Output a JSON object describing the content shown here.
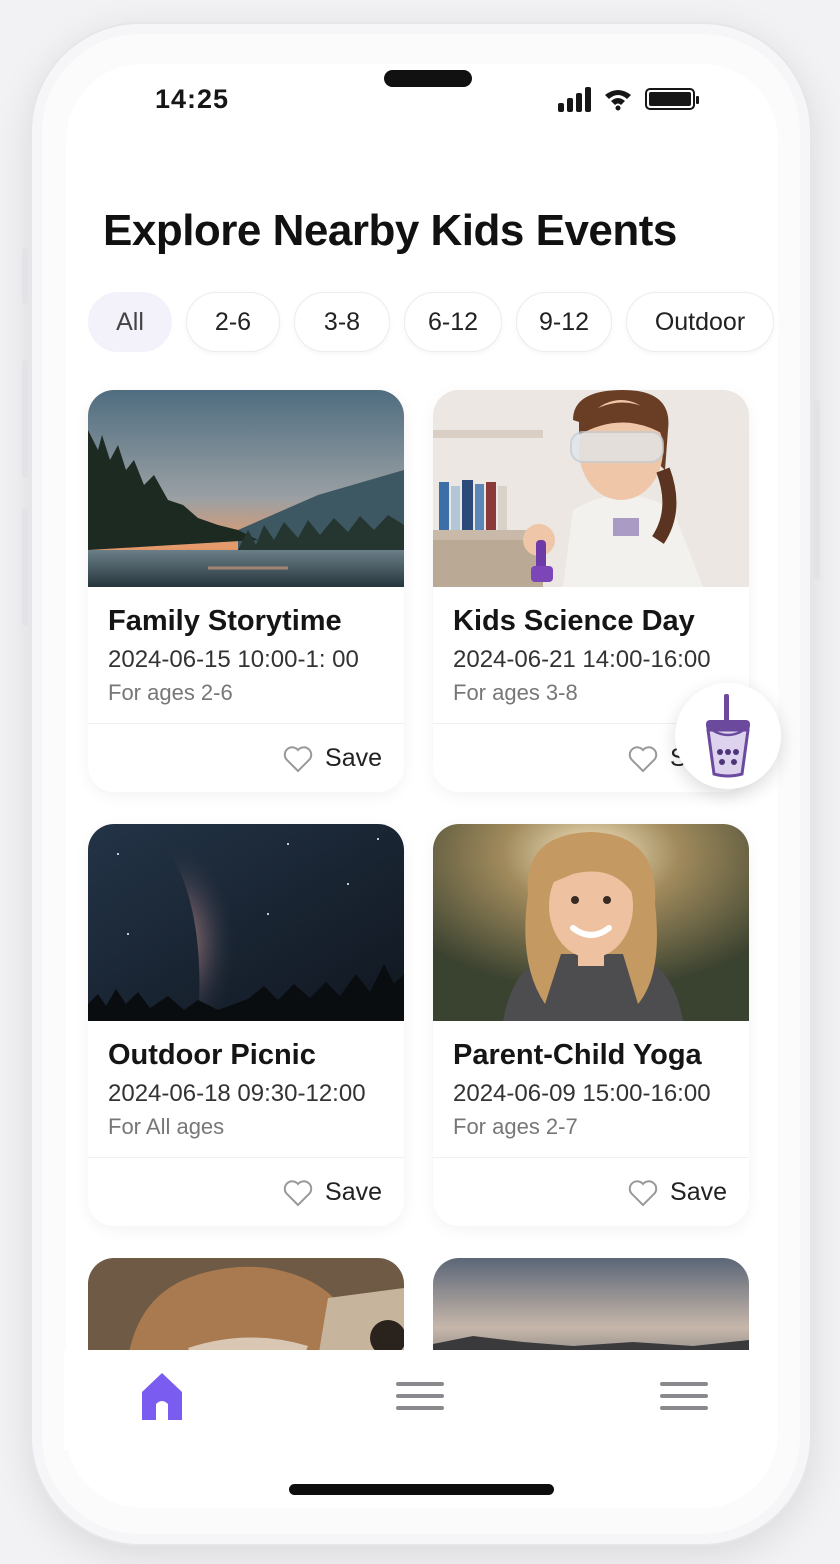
{
  "status_bar": {
    "time": "14:25"
  },
  "page": {
    "title": "Explore Nearby Kids Events"
  },
  "filters": [
    {
      "label": "All",
      "active": true
    },
    {
      "label": "2-6",
      "active": false
    },
    {
      "label": "3-8",
      "active": false
    },
    {
      "label": "6-12",
      "active": false
    },
    {
      "label": "9-12",
      "active": false
    },
    {
      "label": "Outdoor",
      "active": false
    }
  ],
  "events": [
    {
      "name": "Family Storytime",
      "date": "2024-06-15 10:00-1: 00",
      "ages": "For ages 2-6",
      "save_label": "Save",
      "image": "lake-sunset"
    },
    {
      "name": "Kids Science Day",
      "date": "2024-06-21 14:00-16:00",
      "ages": "For ages 3-8",
      "save_label": "Save",
      "image": "girl-science-goggles"
    },
    {
      "name": "Outdoor Picnic",
      "date": "2024-06-18 09:30-12:00",
      "ages": "For All ages",
      "save_label": "Save",
      "image": "milky-way-night"
    },
    {
      "name": "Parent-Child Yoga",
      "date": "2024-06-09 15:00-16:00",
      "ages": "For ages 2-7",
      "save_label": "Save",
      "image": "smiling-woman-portrait"
    }
  ],
  "more_events_images": [
    "person-sweater",
    "dusk-landscape"
  ],
  "floating_button": {
    "icon": "bubble-tea-icon"
  },
  "tab_bar": [
    {
      "icon": "home-icon",
      "active": true
    },
    {
      "icon": "list-icon",
      "active": false
    },
    {
      "icon": "menu-icon",
      "active": false
    }
  ],
  "colors": {
    "accent": "#7b5cf0",
    "fab_purple": "#6b4a9e"
  }
}
